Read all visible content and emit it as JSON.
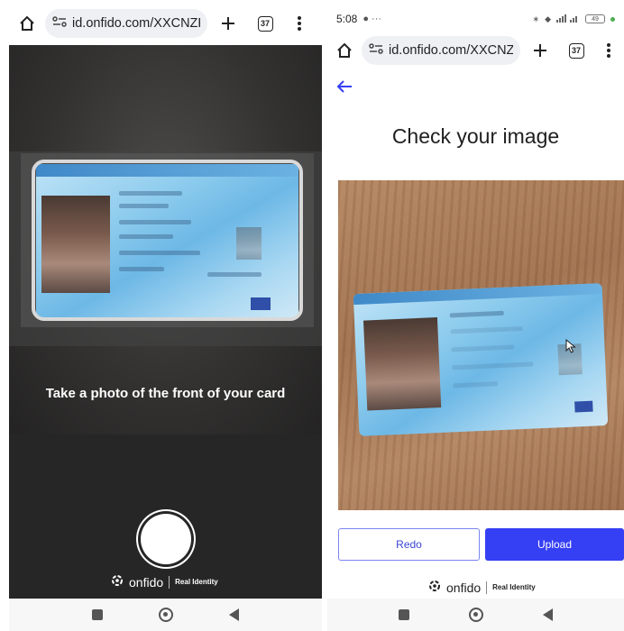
{
  "left": {
    "browser": {
      "url": "id.onfido.com/XXCNZRC",
      "tab_count": "37"
    },
    "camera": {
      "caption": "Take a photo of the front of your card"
    },
    "brand": {
      "name": "onfido",
      "tagline": "Real Identity"
    }
  },
  "right": {
    "status": {
      "time": "5:08",
      "battery": "49"
    },
    "browser": {
      "url": "id.onfido.com/XXCNZRC",
      "tab_count": "37"
    },
    "page": {
      "title": "Check your image",
      "redo_label": "Redo",
      "upload_label": "Upload"
    },
    "brand": {
      "name": "onfido",
      "tagline": "Real Identity"
    }
  },
  "colors": {
    "accent": "#353ff4",
    "camera_bg": "#272626"
  }
}
